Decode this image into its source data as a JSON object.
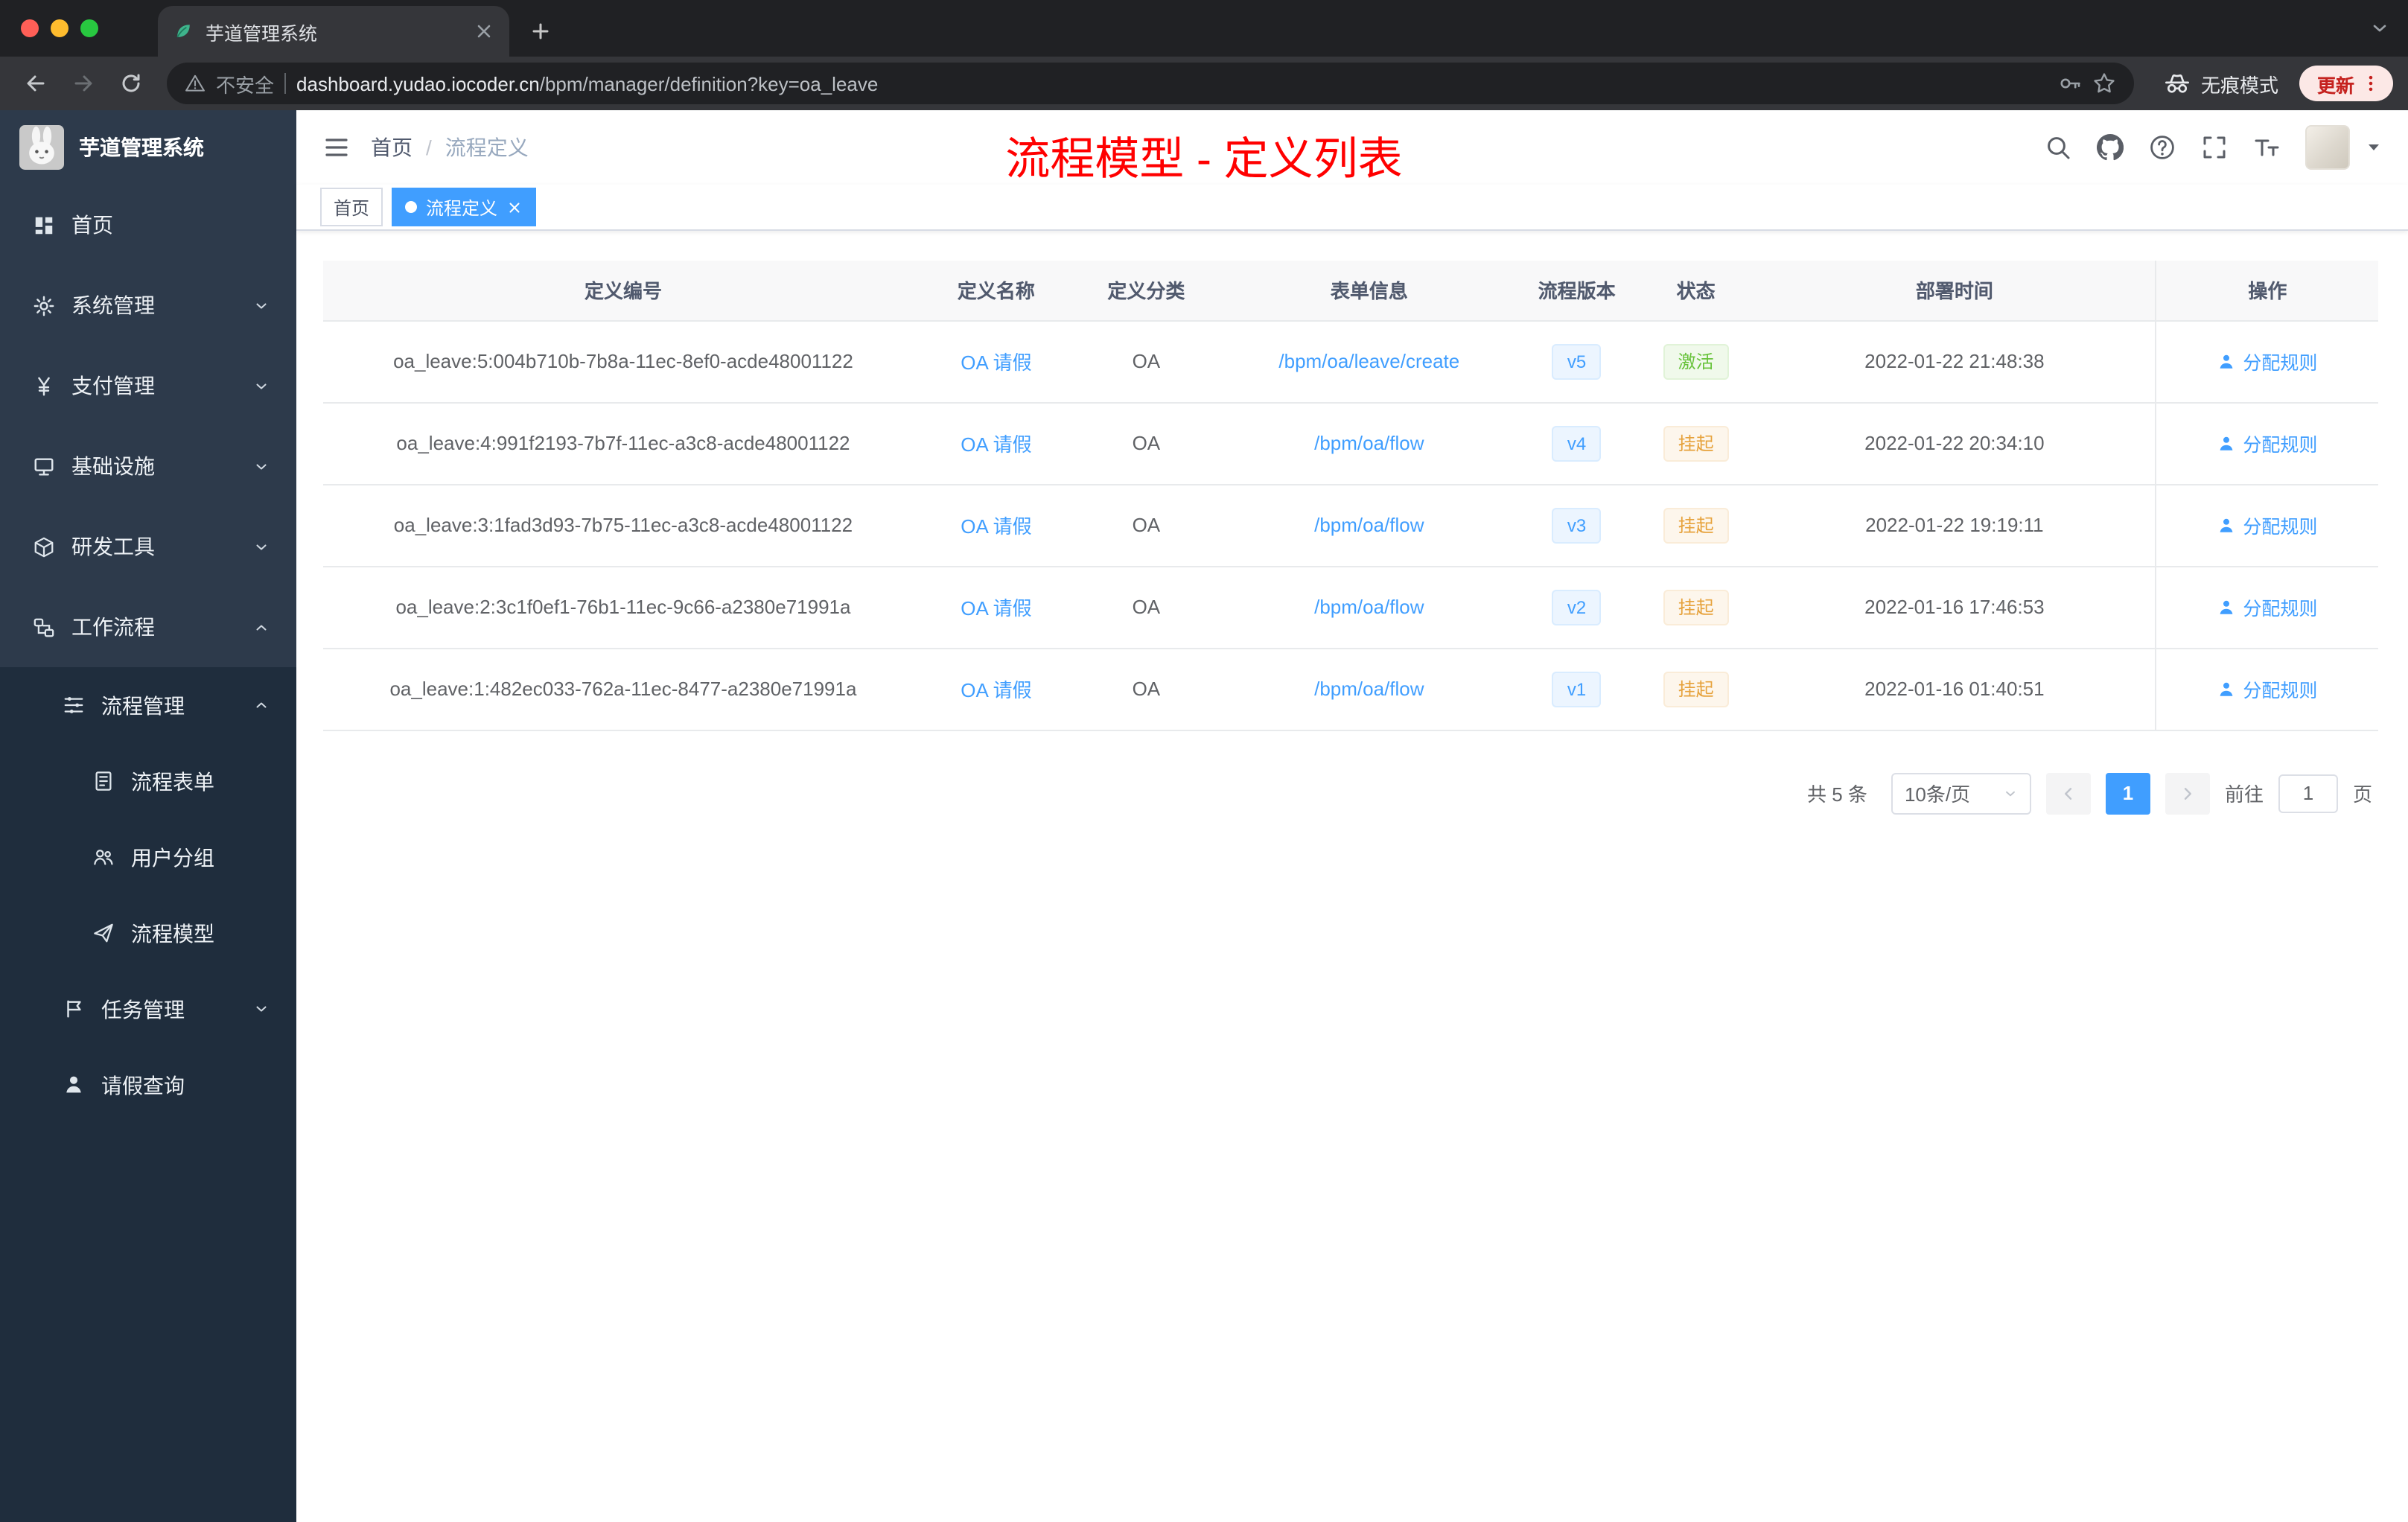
{
  "browser": {
    "tab_title": "芋道管理系统",
    "security_label": "不安全",
    "url_host": "dashboard.yudao.iocoder.cn",
    "url_path": "/bpm/manager/definition?key=oa_leave",
    "incognito_label": "无痕模式",
    "update_label": "更新"
  },
  "sidebar": {
    "logo_title": "芋道管理系统",
    "items": [
      {
        "key": "home",
        "label": "首页",
        "icon": "dashboard-icon",
        "level": 1,
        "expandable": false,
        "expanded": false
      },
      {
        "key": "system",
        "label": "系统管理",
        "icon": "gear-icon",
        "level": 1,
        "expandable": true,
        "expanded": false
      },
      {
        "key": "payment",
        "label": "支付管理",
        "icon": "yen-icon",
        "level": 1,
        "expandable": true,
        "expanded": false
      },
      {
        "key": "infra",
        "label": "基础设施",
        "icon": "infra-icon",
        "level": 1,
        "expandable": true,
        "expanded": false
      },
      {
        "key": "devtools",
        "label": "研发工具",
        "icon": "tools-icon",
        "level": 1,
        "expandable": true,
        "expanded": false
      },
      {
        "key": "workflow",
        "label": "工作流程",
        "icon": "workflow-icon",
        "level": 1,
        "expandable": true,
        "expanded": true
      },
      {
        "key": "process-manage",
        "label": "流程管理",
        "icon": "flow-manage-icon",
        "level": 2,
        "expandable": true,
        "expanded": true
      },
      {
        "key": "process-form",
        "label": "流程表单",
        "icon": "form-icon",
        "level": 3,
        "expandable": false,
        "expanded": false
      },
      {
        "key": "user-group",
        "label": "用户分组",
        "icon": "user-group-icon",
        "level": 3,
        "expandable": false,
        "expanded": false
      },
      {
        "key": "process-model",
        "label": "流程模型",
        "icon": "paper-plane-icon",
        "level": 3,
        "expandable": false,
        "expanded": false
      },
      {
        "key": "task-manage",
        "label": "任务管理",
        "icon": "task-icon",
        "level": 2,
        "expandable": true,
        "expanded": false
      },
      {
        "key": "leave-query",
        "label": "请假查询",
        "icon": "person-icon",
        "level": 2,
        "expandable": false,
        "expanded": false
      }
    ]
  },
  "header": {
    "breadcrumb": {
      "home": "首页",
      "separator": "/",
      "current": "流程定义"
    },
    "annotation": "流程模型 - 定义列表"
  },
  "tags": [
    {
      "label": "首页",
      "active": false,
      "closable": false
    },
    {
      "label": "流程定义",
      "active": true,
      "closable": true
    }
  ],
  "table": {
    "columns": [
      "定义编号",
      "定义名称",
      "定义分类",
      "表单信息",
      "流程版本",
      "状态",
      "部署时间",
      "操作"
    ],
    "rows": [
      {
        "id": "oa_leave:5:004b710b-7b8a-11ec-8ef0-acde48001122",
        "name": "OA 请假",
        "category": "OA",
        "form": "/bpm/oa/leave/create",
        "version": "v5",
        "status": "激活",
        "status_type": "success",
        "time": "2022-01-22 21:48:38",
        "action": "分配规则"
      },
      {
        "id": "oa_leave:4:991f2193-7b7f-11ec-a3c8-acde48001122",
        "name": "OA 请假",
        "category": "OA",
        "form": "/bpm/oa/flow",
        "version": "v4",
        "status": "挂起",
        "status_type": "warning",
        "time": "2022-01-22 20:34:10",
        "action": "分配规则"
      },
      {
        "id": "oa_leave:3:1fad3d93-7b75-11ec-a3c8-acde48001122",
        "name": "OA 请假",
        "category": "OA",
        "form": "/bpm/oa/flow",
        "version": "v3",
        "status": "挂起",
        "status_type": "warning",
        "time": "2022-01-22 19:19:11",
        "action": "分配规则"
      },
      {
        "id": "oa_leave:2:3c1f0ef1-76b1-11ec-9c66-a2380e71991a",
        "name": "OA 请假",
        "category": "OA",
        "form": "/bpm/oa/flow",
        "version": "v2",
        "status": "挂起",
        "status_type": "warning",
        "time": "2022-01-16 17:46:53",
        "action": "分配规则"
      },
      {
        "id": "oa_leave:1:482ec033-762a-11ec-8477-a2380e71991a",
        "name": "OA 请假",
        "category": "OA",
        "form": "/bpm/oa/flow",
        "version": "v1",
        "status": "挂起",
        "status_type": "warning",
        "time": "2022-01-16 01:40:51",
        "action": "分配规则"
      }
    ]
  },
  "pagination": {
    "total_label": "共 5 条",
    "page_size_label": "10条/页",
    "current_page": "1",
    "goto_label": "前往",
    "goto_value": "1",
    "unit_label": "页"
  },
  "colors": {
    "primary": "#409eff",
    "success": "#67c23a",
    "warning": "#e6a23c",
    "annotation_red": "#ff0000",
    "sidebar_bg": "#2d3a4b",
    "submenu_bg": "#1f2d3d"
  }
}
